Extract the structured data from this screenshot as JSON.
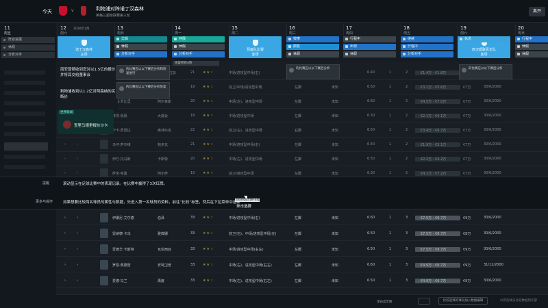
{
  "topbar": {
    "today": "今天",
    "vs": "v",
    "headline": "利物浦对阵诺丁汉森林",
    "subline": "英格兰超级联赛第三轮",
    "close": "离开"
  },
  "leftnav": {
    "day_num": "11",
    "day_name": "周五",
    "buttons": [
      "阵容进展",
      "休假",
      "分析对手"
    ]
  },
  "calendar": {
    "days": [
      {
        "num": "12",
        "wd": "周六",
        "extra": "2030年1月"
      },
      {
        "num": "13",
        "wd": "周日",
        "extra": ""
      },
      {
        "num": "14",
        "wd": "周一",
        "extra": ""
      },
      {
        "num": "15",
        "wd": "周二",
        "extra": ""
      },
      {
        "num": "16",
        "wd": "周三",
        "extra": ""
      },
      {
        "num": "17",
        "wd": "周四",
        "extra": ""
      },
      {
        "num": "18",
        "wd": "周五",
        "extra": ""
      },
      {
        "num": "19",
        "wd": "周六",
        "extra": ""
      },
      {
        "num": "20",
        "wd": "周日",
        "extra": ""
      }
    ],
    "big_tiles": [
      {
        "label": "诺丁汉森林",
        "sub": "主场"
      },
      {
        "label": "预备队比赛",
        "sub": "客场"
      },
      {
        "label": "西汉姆联青年队",
        "sub": "客场"
      }
    ],
    "tiles_row1": [
      "剪辑",
      "伸展",
      "按摩",
      "行程中",
      "继续",
      "休息",
      "行程中"
    ],
    "tiles_row2": [
      "休假",
      "休假",
      "康复",
      "出现",
      "行程中",
      "休假"
    ],
    "tiles_row3": [
      "分析对手",
      "分析对手",
      "休假",
      "休假",
      "分析对手",
      "休假"
    ],
    "pill": "恢复所有4项"
  },
  "notes": [
    "南安普顿收到您对以1.5亿的报价并将其交给董事会",
    "利物浦收到以1.2亿对阿森纳的买断价"
  ],
  "news": {
    "tag": "世界新闻",
    "text": "查里马德里报价沙卡"
  },
  "popcards": [
    {
      "text": "的比赛应以以下赛后分析和恢复进行"
    },
    {
      "text": "的比赛应以以下赛后分析恢复"
    },
    {
      "text": "的比赛应以以下赛后分析"
    },
    {
      "text": "的比赛应以以下赛后分析"
    }
  ],
  "tutorial": {
    "label1": "提醒",
    "text1": "滚动显示在足球比赛中的表现记录。在比赛中赢得了3次红牌。",
    "label2": "更多与操作",
    "text2": "如果想要比较两名球员的属性与数据，先进入第一名球员的资料，前往“比较”标签，然后在下拉菜单中选择",
    "tip": "点击比较球员进行比较",
    "tip_btn": "单击选择"
  },
  "rows": [
    {
      "name": "基丁区·布鲁斯曼",
      "club": "保罗·布拉加",
      "age": "21",
      "stars": "★★☆",
      "pos": "中场/进攻型中场(右)",
      "foot": "左脚",
      "fee": "未知",
      "rating": "6.40",
      "a": "1",
      "b": "2",
      "val": "€1.4万 - €1.8万",
      "wage": "€7万",
      "exp": "30/6/2000"
    },
    {
      "name": "达米安·利德顿",
      "club": "普拉托",
      "age": "19",
      "stars": "★★☆",
      "pos": "前卫/中场/进攻型中场",
      "foot": "左脚",
      "fee": "未知",
      "rating": "6.50",
      "a": "1",
      "b": "2",
      "val": "€3.1万 - €5.6万",
      "wage": "€7万",
      "exp": "30/6/2000"
    },
    {
      "name": "约翰·罗比里",
      "club": "阿尔卑斯",
      "age": "20",
      "stars": "★★☆",
      "pos": "中场(左)、进攻型中场",
      "foot": "左脚",
      "fee": "未知",
      "rating": "6.60",
      "a": "1",
      "b": "2",
      "val": "€4.5万 - €7.0万",
      "wage": "€7万",
      "exp": "30/6/2000"
    },
    {
      "name": "彼得·佩佩",
      "club": "大都会",
      "age": "18",
      "stars": "★★☆",
      "pos": "中场/进攻型中场",
      "foot": "左脚",
      "fee": "未知",
      "rating": "6.30",
      "a": "1",
      "b": "2",
      "val": "€2.1万 - €4.1万",
      "wage": "€7万",
      "exp": "30/6/2000"
    },
    {
      "name": "卢卡·费雷拉",
      "club": "奥林匹克",
      "age": "22",
      "stars": "★★☆",
      "pos": "前卫(右)、进攻型中场",
      "foot": "右脚",
      "fee": "未知",
      "rating": "6.50",
      "a": "1",
      "b": "2",
      "val": "€3.4万 - €6.7万",
      "wage": "€7万",
      "exp": "30/6/2000"
    },
    {
      "name": "马可·萨尔维",
      "club": "帕多瓦",
      "age": "21",
      "stars": "★★☆",
      "pos": "中场/进攻型中场(右)",
      "foot": "左脚",
      "fee": "未知",
      "rating": "6.40",
      "a": "1",
      "b": "2",
      "val": "€1.9万 - €3.1万",
      "wage": "€7万",
      "exp": "30/6/2000"
    },
    {
      "name": "伊万·托马斯",
      "club": "卡斯特",
      "age": "20",
      "stars": "★★☆",
      "pos": "中场(右)、进攻型中场",
      "foot": "左脚",
      "fee": "未知",
      "rating": "6.50",
      "a": "1",
      "b": "2",
      "val": "€2.2万 - €4.2万",
      "wage": "€7万",
      "exp": "30/6/2000"
    },
    {
      "name": "萨米·哈桑",
      "club": "阿尔萨",
      "age": "19",
      "stars": "★★☆",
      "pos": "前卫/进攻型中场",
      "foot": "左脚",
      "fee": "未知",
      "rating": "6.30",
      "a": "1",
      "b": "2",
      "val": "€4.1万 - €7.2万",
      "wage": "€7万",
      "exp": "30/6/2000"
    },
    {
      "name": "罗梅·艾尔森",
      "club": "索菲亚",
      "age": "22",
      "stars": "★★☆",
      "pos": "中场/进攻型中场(右)",
      "foot": "左脚",
      "fee": "未知",
      "rating": "6.40",
      "a": "1",
      "b": "2",
      "val": "€3.8万 - €6.1万",
      "wage": "€7万",
      "exp": "30/6/2000"
    },
    {
      "name": "伊利亚·罗斯",
      "club": "皇家马德里",
      "age": "18",
      "stars": "★★☆",
      "pos": "中场(右)、进攻型中场",
      "foot": "右脚",
      "fee": "未知",
      "rating": "6.50",
      "a": "1",
      "b": "2",
      "val": "€2.3万 - €5.1万",
      "wage": "€7万",
      "exp": "30/6/2000"
    }
  ],
  "rows_bright": [
    {
      "name": "伊娜尼·艾尔德",
      "club": "伯泽",
      "age": "33",
      "stars": "★★☆",
      "pos": "中场/进攻型中场(右)",
      "foot": "左脚",
      "fee": "未知",
      "rating": "6.60",
      "a": "1",
      "b": "3",
      "val": "€7.5万 - €9.7万",
      "wage": "€9万",
      "exp": "30/6/2000"
    },
    {
      "name": "雷纳德·卡乌",
      "club": "雅典娜",
      "age": "33",
      "stars": "★★☆",
      "pos": "前卫(右)、中场/进攻型中场(左)",
      "foot": "左脚",
      "fee": "未知",
      "rating": "6.50",
      "a": "1",
      "b": "3",
      "val": "€7.5万 - €9.7万",
      "wage": "€8万",
      "exp": "30/6/2000"
    },
    {
      "name": "爱德华·卡斯特",
      "club": "瓦伦西亚",
      "age": "33",
      "stars": "★★☆",
      "pos": "中场/进攻型中场(右左)",
      "foot": "左脚",
      "fee": "未知",
      "rating": "6.50",
      "a": "1",
      "b": "3",
      "val": "€7.5万 - €9.7万",
      "wage": "€9万",
      "exp": "30/6/2000"
    },
    {
      "name": "罗恩·佩德雷",
      "club": "安特卫普",
      "age": "33",
      "stars": "★★☆",
      "pos": "中场(右)、进攻型中场(右左)",
      "foot": "左脚",
      "fee": "未知",
      "rating": "6.60",
      "a": "1",
      "b": "3",
      "val": "€4.9万 - €6.7万",
      "wage": "€9万",
      "exp": "31/12/2000"
    },
    {
      "name": "爱德·冯兰",
      "club": "再度",
      "age": "33",
      "stars": "★★☆",
      "pos": "中场(右)、进攻型中场(右左)",
      "foot": "左脚",
      "fee": "未知",
      "rating": "6.50",
      "a": "1",
      "b": "3",
      "val": "€4.9万 - €6.7万",
      "wage": "€9万",
      "exp": "30/6/2000"
    }
  ],
  "bottombar": {
    "pager_label": "球员显示数",
    "btn1": "比较选择的球员加入数据编辑",
    "btn2": "以所选球员比较数据到外部"
  }
}
